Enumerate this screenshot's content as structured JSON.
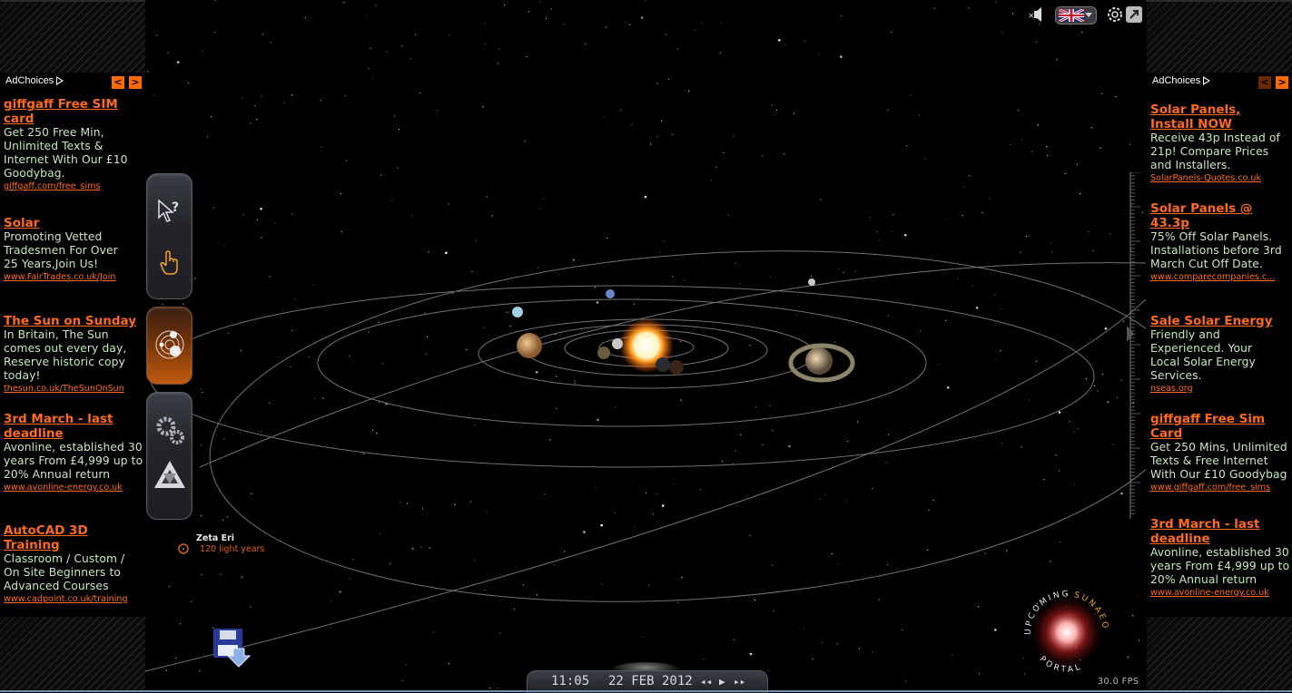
{
  "left_ads": {
    "adchoices_label": "AdChoices",
    "prev_label": "<",
    "next_label": ">",
    "items": [
      {
        "title": "giffgaff Free SIM card",
        "body": "Get 250 Free Min, Unlimited Texts & Internet With Our £10 Goodybag.",
        "url": "giffgaff.com/free_sims"
      },
      {
        "title": "Solar",
        "body": "Promoting Vetted Tradesmen For Over 25 Years,Join Us!",
        "url": "www.FairTrades.co.uk/Join"
      },
      {
        "title": "The Sun on Sunday",
        "body": "In Britain, The Sun comes out every day, Reserve historic copy today!",
        "url": "thesun.co.uk/TheSunOnSun"
      },
      {
        "title": "3rd March - last deadline",
        "body": "Avonline, established 30 years From £4,999 up to 20% Annual return",
        "url": "www.avonline-energy.co.uk"
      },
      {
        "title": "AutoCAD 3D Training",
        "body": "Classroom / Custom / On Site Beginners to Advanced Courses",
        "url": "www.cadpoint.co.uk/training"
      }
    ]
  },
  "right_ads": {
    "adchoices_label": "AdChoices",
    "prev_label": "<",
    "next_label": ">",
    "items": [
      {
        "title": "Solar Panels, Install NOW",
        "body": "Receive 43p Instead of 21p! Compare Prices and Installers.",
        "url": "SolarPanels-Quotes.co.uk"
      },
      {
        "title": "Solar Panels @ 43.3p",
        "body": "75% Off Solar Panels. Installations before 3rd March Cut Off Date.",
        "url": "www.comparecompanies.c..."
      },
      {
        "title": "Sale Solar Energy",
        "body": "Friendly and Experienced. Your Local Solar Energy Services.",
        "url": "nseas.org"
      },
      {
        "title": "giffgaff Free Sim Card",
        "body": "Get 250 Mins, Unlimited Texts & Free Internet With Our £10 Goodybag",
        "url": "www.giffgaff.com/free_sims"
      },
      {
        "title": "3rd March - last deadline",
        "body": "Avonline, established 30 years From £4,999 up to 20% Annual return",
        "url": "www.avonline-energy.co.uk"
      }
    ]
  },
  "top_controls": {
    "icons": [
      "mute-speaker-icon",
      "language-flag-icon",
      "settings-camera-icon",
      "fullscreen-icon"
    ]
  },
  "toolbar": {
    "icons": [
      "cursor-help-icon",
      "hand-pointer-icon",
      "solar-system-icon",
      "gears-icon",
      "triangle-logo-icon"
    ]
  },
  "star_label": {
    "name": "Zeta Eri",
    "distance": "120 light years"
  },
  "timebar": {
    "time": "11:05",
    "date": "22 FEB 2012",
    "rewind": "◂◂",
    "play": "▶",
    "forward": "▸▸"
  },
  "portal": {
    "word_upcoming": "UPCOMING",
    "word_sunaeon": "SUNAEON",
    "word_portal": "PORTAL"
  },
  "fps": "30.0 FPS",
  "colors": {
    "accent": "#ff6a1a",
    "ad_body": "#c8e8c0",
    "background": "#000000"
  }
}
